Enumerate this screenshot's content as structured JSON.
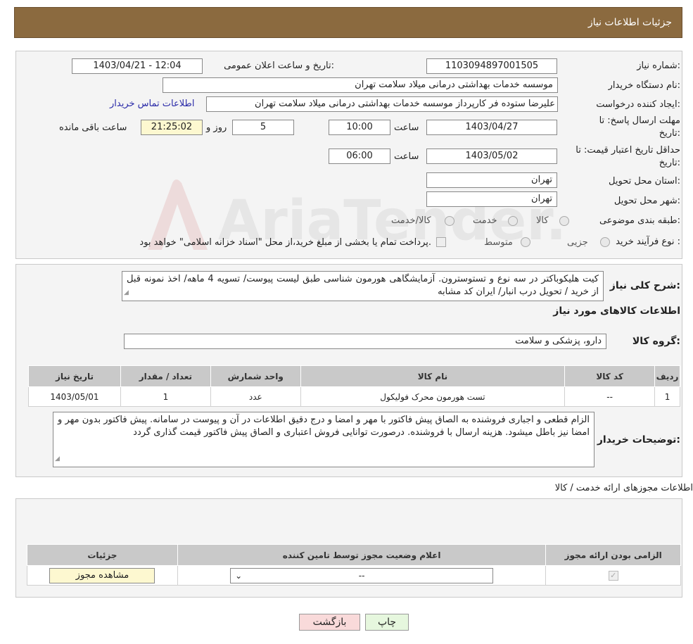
{
  "header": {
    "title": "جزئیات اطلاعات نیاز"
  },
  "watermark": {
    "text": "AriaTender.neT"
  },
  "info": {
    "need_number_label": "شماره نیاز:",
    "need_number": "1103094897001505",
    "announce_label": "تاریخ و ساعت اعلان عمومی:",
    "announce_value": "1403/04/21 - 12:04",
    "buyer_label": "نام دستگاه خریدار:",
    "buyer_value": "موسسه خدمات بهداشتی درمانی میلاد سلامت تهران",
    "creator_label": "ایجاد کننده درخواست:",
    "creator_value": "علیرضا ستوده فر کارپرداز موسسه خدمات بهداشتی درمانی میلاد سلامت تهران",
    "contact_link": "اطلاعات تماس خریدار",
    "deadline_label_1": "مهلت ارسال پاسخ: تا",
    "deadline_label_2": "تاریخ:",
    "deadline_date": "1403/04/27",
    "time_label": "ساعت",
    "deadline_time": "10:00",
    "days_value": "5",
    "days_label": "روز و",
    "remaining_value": "21:25:02",
    "remaining_label": "ساعت باقی مانده",
    "validity_label_1": "حداقل تاریخ اعتبار قیمت: تا",
    "validity_label_2": "تاریخ:",
    "validity_date": "1403/05/02",
    "validity_time_label": "ساعت",
    "validity_time": "06:00",
    "province_label": "استان محل تحویل:",
    "province_value": "تهران",
    "city_label": "شهر محل تحویل:",
    "city_value": "تهران",
    "category_label": "طبقه بندی موضوعی:",
    "category_options": [
      "کالا",
      "خدمت",
      "کالا/خدمت"
    ],
    "process_label": "نوع فرآیند خرید :",
    "process_options": [
      "جزیی",
      "متوسط"
    ],
    "process_note": "پرداخت تمام یا بخشی از مبلغ خرید،از محل \"اسناد خزانه اسلامی\" خواهد بود."
  },
  "summary": {
    "label": "شرح کلی نیاز:",
    "text": "کیت هلیکوباکتر در سه نوع و تستوسترون. آزمایشگاهی هورمون شناسی طبق لیست پیوست/ تسویه 4 ماهه/ اخذ نمونه قبل از خرید / تحویل درب انبار/ ایران کد مشابه",
    "goods_title": "اطلاعات کالاهای مورد نیاز",
    "group_label": "گروه کالا:",
    "group_value": "دارو، پزشکی و سلامت"
  },
  "goods_table": {
    "headers": [
      "ردیف",
      "کد کالا",
      "نام کالا",
      "واحد شمارش",
      "تعداد / مقدار",
      "تاریخ نیاز"
    ],
    "rows": [
      [
        "1",
        "--",
        "تست هورمون محرک فولیکول",
        "عدد",
        "1",
        "1403/05/01"
      ]
    ]
  },
  "buyer_notes": {
    "label": "توضیحات خریدار:",
    "text": "الزام قطعی و اجباری فروشنده به الصاق پیش فاکتور با مهر و امضا و درج دقیق اطلاعات در آن و پیوست در سامانه. پیش فاکتور بدون مهر و امضا نیز باطل میشود. هزینه ارسال با فروشنده. درصورت توانایی فروش اعتباری و الصاق پیش فاکتور قیمت گذاری گردد"
  },
  "permits": {
    "title": "اطلاعات مجوزهای ارائه خدمت / کالا",
    "headers": [
      "الزامی بودن ارائه مجوز",
      "اعلام وضعیت مجوز توسط تامین کننده",
      "جزئیات"
    ],
    "select_value": "--",
    "view_button": "مشاهده مجوز"
  },
  "footer": {
    "print_label": "چاپ",
    "back_label": "بازگشت"
  },
  "colors": {
    "header_bg": "#8b6a3f",
    "table_header": "#c9c9c9",
    "remaining_bg": "#fdf8d0",
    "back_bg": "#f9dada",
    "print_bg": "#e6f7de"
  }
}
